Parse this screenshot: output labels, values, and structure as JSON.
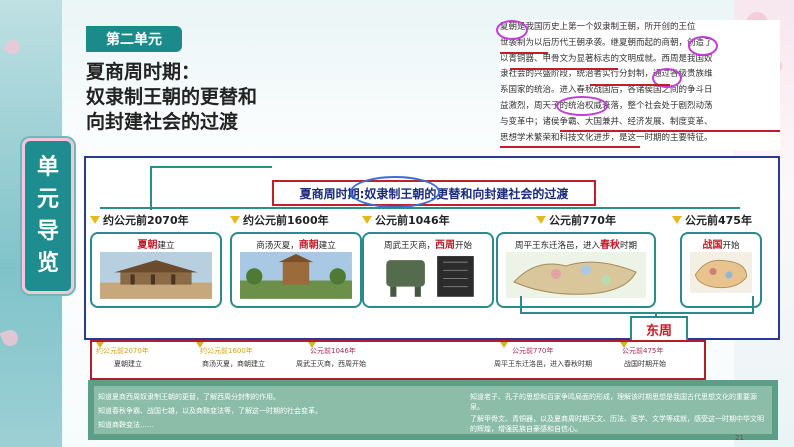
{
  "unit_tab": "第二单元",
  "title_lines": [
    "夏商周时期：",
    "奴隶制王朝的更替和",
    "向封建社会的过渡"
  ],
  "banner": [
    "单",
    "元",
    "导",
    "览"
  ],
  "textbook_lines": [
    "夏朝是我国历史上第一个奴隶制王朝，所开创的王位",
    "世袭制为以后历代王朝承袭。继夏朝而起的商朝，创造了",
    "以青铜器、甲骨文为显著标志的文明成就。西周是我国奴",
    "隶社会的兴盛阶段，统治者实行分封制，通过各级贵族维",
    "系国家的统治。进入春秋战国后，各诸侯国之间的争斗日",
    "益激烈，周天子的统治权威衰落，整个社会处于剧烈动荡",
    "与变革中；诸侯争霸、大国兼并、经济发展、制度变革、",
    "思想学术繁荣和科技文化进步，是这一时期的主要特征。"
  ],
  "main_heading": "夏商周时期:奴隶制王朝的更替和向封建社会的过渡",
  "periods": [
    {
      "date": "约公元前2070年",
      "pre": "",
      "key": "夏朝",
      "post": "建立"
    },
    {
      "date": "约公元前1600年",
      "pre": "商汤灭夏，",
      "key": "商朝",
      "post": "建立"
    },
    {
      "date": "公元前1046年",
      "pre": "周武王灭商，",
      "key": "西周",
      "post": "开始"
    },
    {
      "date": "公元前770年",
      "pre": "周平王东迁洛邑，进入",
      "key": "春秋",
      "post": "时期"
    },
    {
      "date": "公元前475年",
      "pre": "",
      "key": "战国",
      "post": "开始"
    }
  ],
  "east_zhou": "东周",
  "bottom_timeline": [
    {
      "date": "约公元前2070年",
      "event": "夏朝建立"
    },
    {
      "date": "约公元前1600年",
      "event": "商汤灭夏，商朝建立"
    },
    {
      "date": "公元前1046年",
      "event": "周武王灭商，西周开始"
    },
    {
      "date": "公元前770年",
      "event": "周平王东迁洛邑，进入春秋时期"
    },
    {
      "date": "公元前475年",
      "event": "战国时期开始"
    }
  ],
  "goals_left": [
    "知道夏商西周奴隶制王朝的更替，了解西周分封制的作用。",
    "知道春秋争霸、战国七雄，以及商鞅变法等，了解这一时期的社会变革。",
    "知道商鞅变法……"
  ],
  "goals_right": [
    "知道老子、孔子的思想和百家争鸣局面的形成，理解该时期思想是我国古代思想文化的重要源泉。",
    "了解甲骨文、青铜器，以及夏商周时期天文、历法、医学、文学等成就，感受这一时期中华文明的辉煌，增强民族自豪感和自信心。"
  ],
  "page_number": "21"
}
